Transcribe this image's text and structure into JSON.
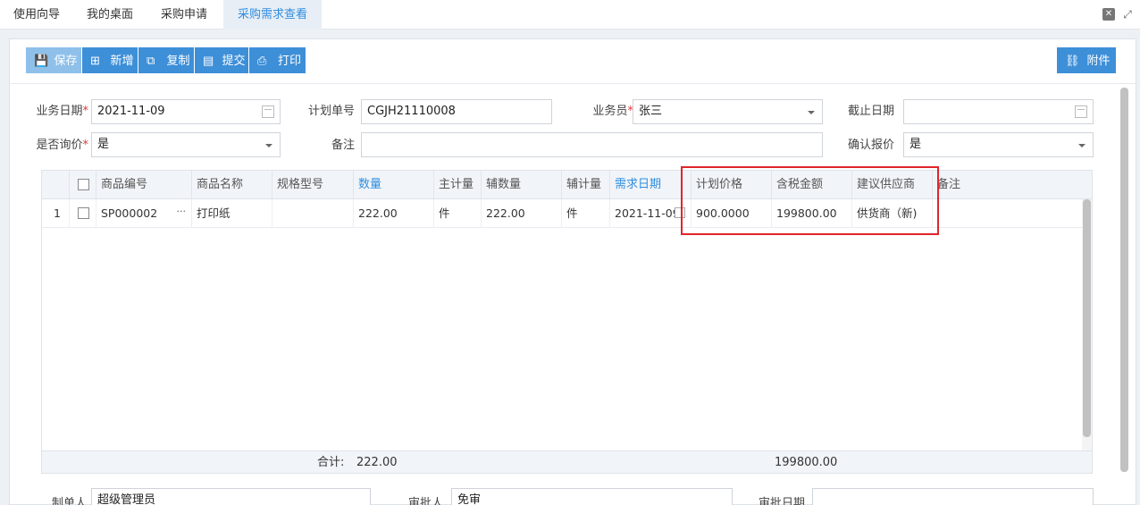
{
  "tabs": [
    {
      "label": "使用向导"
    },
    {
      "label": "我的桌面"
    },
    {
      "label": "采购申请"
    },
    {
      "label": "采购需求查看"
    }
  ],
  "toolbar": {
    "save": "保存",
    "add": "新增",
    "copy": "复制",
    "submit": "提交",
    "print": "打印",
    "attach": "附件"
  },
  "form": {
    "biz_date_label": "业务日期",
    "biz_date": "2021-11-09",
    "plan_no_label": "计划单号",
    "plan_no": "CGJH21110008",
    "salesman_label": "业务员",
    "salesman": "张三",
    "deadline_label": "截止日期",
    "deadline": "",
    "inquiry_label": "是否询价",
    "inquiry": "是",
    "remark_label": "备注",
    "remark": "",
    "confirm_quote_label": "确认报价",
    "confirm_quote": "是",
    "required_mark": "*"
  },
  "grid": {
    "headers": {
      "code": "商品编号",
      "name": "商品名称",
      "spec": "规格型号",
      "qty": "数量",
      "unit": "主计量",
      "aux_qty": "辅数量",
      "aux_unit": "辅计量",
      "need_date": "需求日期",
      "plan_price": "计划价格",
      "tax_amount": "含税金额",
      "supplier": "建议供应商",
      "remark": "备注"
    },
    "rows": [
      {
        "index": "1",
        "code": "SP000002",
        "more": "···",
        "name": "打印纸",
        "spec": "",
        "qty": "222.00",
        "unit": "件",
        "aux_qty": "222.00",
        "aux_unit": "件",
        "need_date": "2021-11-09",
        "plan_price": "900.0000",
        "tax_amount": "199800.00",
        "supplier": "供货商（新)",
        "remark": ""
      }
    ],
    "footer": {
      "label": "合计:",
      "qty_total": "222.00",
      "amount_total": "199800.00"
    }
  },
  "bottom_form": {
    "maker_label": "制单人",
    "maker": "超级管理员",
    "approver_label": "审批人",
    "approver": "免审",
    "approve_date_label": "审批日期",
    "approve_date": ""
  },
  "colors": {
    "accent": "#3d8fd8",
    "active_tab": "#2f8ee0",
    "required": "#e5363a",
    "highlight_box": "#e0252b"
  }
}
